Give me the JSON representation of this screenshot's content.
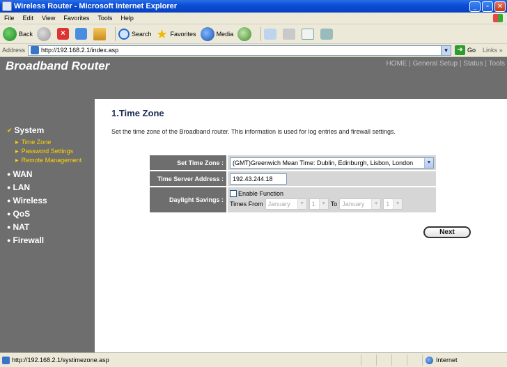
{
  "window": {
    "title": "Wireless Router - Microsoft Internet Explorer"
  },
  "menu": {
    "items": [
      "File",
      "Edit",
      "View",
      "Favorites",
      "Tools",
      "Help"
    ]
  },
  "toolbar": {
    "back": "Back",
    "search": "Search",
    "favorites": "Favorites",
    "media": "Media"
  },
  "address": {
    "label": "Address",
    "url": "http://192.168.2.1/index.asp",
    "go": "Go",
    "links": "Links"
  },
  "header": {
    "brand": "Broadband Router",
    "nav": [
      "HOME",
      "General Setup",
      "Status",
      "Tools"
    ],
    "separator": "|"
  },
  "sidebar": {
    "current_section": "System",
    "sub_items": [
      "Time Zone",
      "Password Settings",
      "Remote Management"
    ],
    "sections": [
      "WAN",
      "LAN",
      "Wireless",
      "QoS",
      "NAT",
      "Firewall"
    ]
  },
  "main": {
    "title": "1.Time Zone",
    "description": "Set the time zone of the Broadband router. This information is used for log entries and firewall settings.",
    "form": {
      "time_zone_label": "Set Time Zone :",
      "time_zone_value": "(GMT)Greenwich Mean Time: Dublin, Edinburgh, Lisbon, London",
      "server_label": "Time Server Address :",
      "server_value": "192.43.244.18",
      "dst_label": "Daylight Savings :",
      "enable_label": "Enable Function",
      "times_from": "Times From",
      "from_month": "January",
      "from_day": "1",
      "to_label": "To",
      "to_month": "January",
      "to_day": "1"
    },
    "next_label": "Next"
  },
  "status": {
    "url": "http://192.168.2.1/systimezone.asp",
    "zone": "Internet"
  },
  "colors": {
    "sidebar_bg": "#6e6e6e",
    "accent_yellow": "#ffd400",
    "title_blue": "#1c2a55"
  }
}
